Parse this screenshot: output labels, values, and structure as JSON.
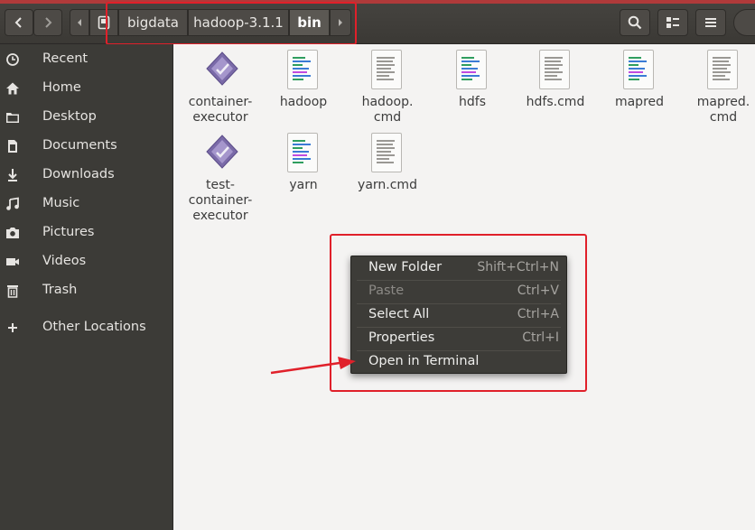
{
  "nav": {
    "back_icon": "chevron-left-icon",
    "forward_icon": "chevron-right-icon",
    "breadcrumbs": [
      "bigdata",
      "hadoop-3.1.1",
      "bin"
    ]
  },
  "toolbar": {
    "search_icon": "search-icon",
    "view_icon": "view-options-icon",
    "menu_icon": "menu-icon"
  },
  "sidebar": {
    "items": [
      {
        "label": "Recent",
        "icon": "clock-icon"
      },
      {
        "label": "Home",
        "icon": "home-icon"
      },
      {
        "label": "Desktop",
        "icon": "folder-icon"
      },
      {
        "label": "Documents",
        "icon": "document-icon"
      },
      {
        "label": "Downloads",
        "icon": "download-icon"
      },
      {
        "label": "Music",
        "icon": "music-icon"
      },
      {
        "label": "Pictures",
        "icon": "camera-icon"
      },
      {
        "label": "Videos",
        "icon": "video-icon"
      },
      {
        "label": "Trash",
        "icon": "trash-icon"
      },
      {
        "label": "Other Locations",
        "icon": "plus-icon"
      }
    ]
  },
  "files": [
    {
      "name1": "container-",
      "name2": "executor",
      "name3": "",
      "type": "executable"
    },
    {
      "name1": "hadoop",
      "name2": "",
      "name3": "",
      "type": "script"
    },
    {
      "name1": "hadoop.",
      "name2": "cmd",
      "name3": "",
      "type": "text"
    },
    {
      "name1": "hdfs",
      "name2": "",
      "name3": "",
      "type": "script"
    },
    {
      "name1": "hdfs.cmd",
      "name2": "",
      "name3": "",
      "type": "text"
    },
    {
      "name1": "mapred",
      "name2": "",
      "name3": "",
      "type": "script"
    },
    {
      "name1": "mapred.",
      "name2": "cmd",
      "name3": "",
      "type": "text"
    },
    {
      "name1": "test-",
      "name2": "container-",
      "name3": "executor",
      "type": "executable"
    },
    {
      "name1": "yarn",
      "name2": "",
      "name3": "",
      "type": "script"
    },
    {
      "name1": "yarn.cmd",
      "name2": "",
      "name3": "",
      "type": "text"
    }
  ],
  "context_menu": {
    "items": [
      {
        "label": "New Folder",
        "accel": "Shift+Ctrl+N",
        "enabled": true
      },
      {
        "label": "Paste",
        "accel": "Ctrl+V",
        "enabled": false
      },
      {
        "label": "Select All",
        "accel": "Ctrl+A",
        "enabled": true
      },
      {
        "label": "Properties",
        "accel": "Ctrl+I",
        "enabled": true
      },
      {
        "label": "Open in Terminal",
        "accel": "",
        "enabled": true
      }
    ]
  },
  "colors": {
    "highlight": "#e0202a",
    "sidebar_bg": "#3c3b37",
    "headerbar_bg": "#3f3d39",
    "menu_bg": "#3d3c38"
  }
}
